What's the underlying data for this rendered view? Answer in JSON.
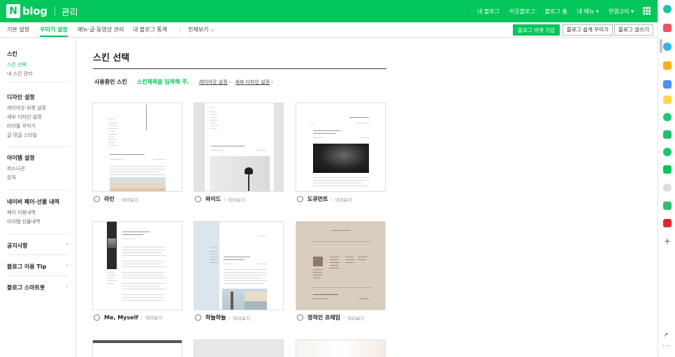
{
  "header": {
    "brand": "blog",
    "brand_icon": "N",
    "section": "관리",
    "links": [
      "내 블로그",
      "이웃블로그",
      "블로그 홈",
      "내 메뉴 ▾",
      "연결고리 ▾"
    ],
    "apps_icon": "grid-icon"
  },
  "subnav": {
    "tabs": [
      "기본 설정",
      "꾸미기 설정",
      "메뉴·글·동영상 관리",
      "내 블로그 통계"
    ],
    "view_all": "전체보기 ⌵",
    "buttons": {
      "market": "블로그 마켓 가입",
      "easy": "블로그 쉽게 꾸미기",
      "write": "블로그 글쓰기"
    }
  },
  "sidebar": {
    "groups": [
      {
        "title": "스킨",
        "items": [
          "스킨 선택",
          "내 스킨 관리"
        ]
      },
      {
        "title": "디자인 설정",
        "items": [
          "레이아웃·위젯 설정",
          "세부 디자인 설정",
          "타이틀 꾸미기",
          "글·댓글 스타일"
        ]
      },
      {
        "title": "아이템 설정",
        "items": [
          "퍼스나콘",
          "뮤직"
        ]
      },
      {
        "title": "네이버 페이·선물 내역",
        "items": [
          "페이 이용내역",
          "아이템 선물내역"
        ]
      }
    ],
    "links": [
      "공지사항",
      "블로그 이용 Tip",
      "블로그 스마트봇"
    ]
  },
  "main": {
    "title": "스킨 선택",
    "using_label": "사용중인 스킨",
    "skin_name_placeholder": "스킨제목을 입력해 주.",
    "layout_link": "레이아웃 설정",
    "detail_link": "세부 디자인 설정",
    "preview_label": "미리보기",
    "skins": [
      "라인",
      "와이드",
      "도큐먼트",
      "Me, Myself",
      "하늘하늘",
      "정적인 프레임"
    ]
  },
  "colors": {
    "brand_green": "#03c75a",
    "border": "#dddddd"
  }
}
